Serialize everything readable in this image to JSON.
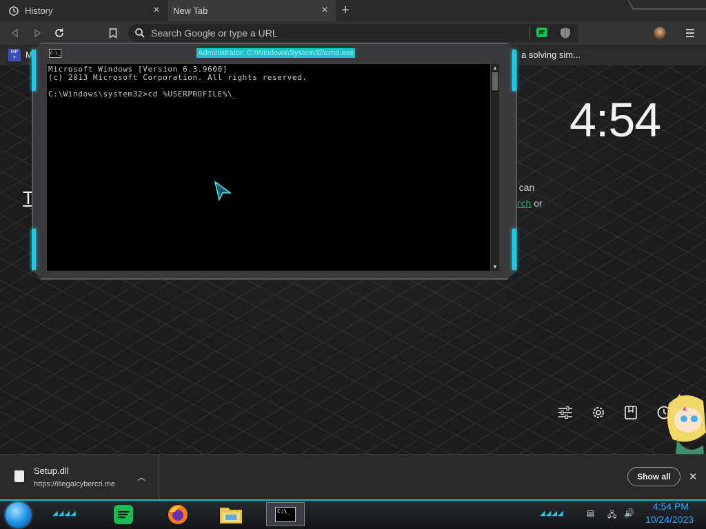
{
  "browser": {
    "tabs": [
      {
        "label": "History"
      },
      {
        "label": "New Tab"
      }
    ],
    "omnibox": {
      "placeholder": "Search Google or type a URL"
    },
    "bookmarks": {
      "left_item": "M",
      "right_item": "a solving sim..."
    }
  },
  "new_tab_page": {
    "clock": "4:54",
    "peek_line1": "u can",
    "peek_link": "erch",
    "peek_line2_rest": " or",
    "left_fragment": "T"
  },
  "cmd": {
    "title": "Administrator: C:\\Windows\\System32\\cmd.exe",
    "icon_text": "C:\\_",
    "lines": [
      "Microsoft Windows [Version 6.3.9600]",
      "(c) 2013 Microsoft Corporation. All rights reserved.",
      "",
      "C:\\Windows\\system32>cd %USERPROFILE%\\_"
    ]
  },
  "downloads": {
    "file_name": "Setup.dll",
    "file_url": "https://illegalcybercri.me",
    "show_all_label": "Show all"
  },
  "taskbar": {
    "time": "4:54 PM",
    "date": "10/24/2023",
    "cmd_icon_text": "C:\\_"
  },
  "icons": [
    "history-icon",
    "close-icon",
    "plus-icon",
    "back-icon",
    "forward-icon",
    "reload-icon",
    "bookmark-icon",
    "search-icon",
    "extension-icon",
    "shield-icon",
    "avatar",
    "menu-icon",
    "customize-icon",
    "gear-icon",
    "reading-list-icon",
    "clock-history-icon",
    "file-icon",
    "chevron-up-icon",
    "start-orb",
    "spotify-icon",
    "firefox-icon",
    "folder-icon",
    "terminal-icon",
    "network-icon",
    "volume-icon"
  ],
  "colors": {
    "accent_cyan": "#1ec9e6",
    "clock_blue": "#2aa9ff",
    "spotify_green": "#1db954"
  }
}
